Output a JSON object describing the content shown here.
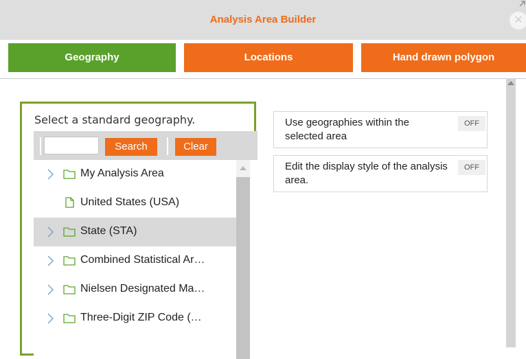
{
  "window": {
    "title": "Analysis Area Builder",
    "close_glyph": "✕",
    "icons": {
      "close": "close-icon",
      "popout": "popout-icon"
    }
  },
  "tabs": [
    {
      "label": "Geography",
      "color": "#5aa12c",
      "active": true
    },
    {
      "label": "Locations",
      "color": "#ef6c1a",
      "active": false
    },
    {
      "label": "Hand drawn polygon",
      "color": "#ef6c1a",
      "active": false
    }
  ],
  "geography_panel": {
    "prompt": "Select a standard geography.",
    "search": {
      "value": "",
      "placeholder": ""
    },
    "search_label": "Search",
    "clear_label": "Clear",
    "tree": [
      {
        "label": "My Analysis Area",
        "type": "folder",
        "expandable": true,
        "selected": false
      },
      {
        "label": "United States (USA)",
        "type": "file",
        "expandable": false,
        "selected": false
      },
      {
        "label": "State (STA)",
        "type": "folder",
        "expandable": true,
        "selected": true
      },
      {
        "label": "Combined Statistical Ar…",
        "type": "folder",
        "expandable": true,
        "selected": false
      },
      {
        "label": "Nielsen Designated Ma…",
        "type": "folder",
        "expandable": true,
        "selected": false
      },
      {
        "label": "Three-Digit ZIP Code (…",
        "type": "folder",
        "expandable": true,
        "selected": false
      }
    ]
  },
  "options": [
    {
      "label": "Use geographies within the selected area",
      "toggle": "OFF"
    },
    {
      "label": "Edit the display style of the analysis area.",
      "toggle": "OFF"
    }
  ],
  "colors": {
    "accent_orange": "#ef6c1a",
    "accent_green": "#5aa12c",
    "panel_border": "#79a22a",
    "selected_row": "#d9d9d9"
  }
}
